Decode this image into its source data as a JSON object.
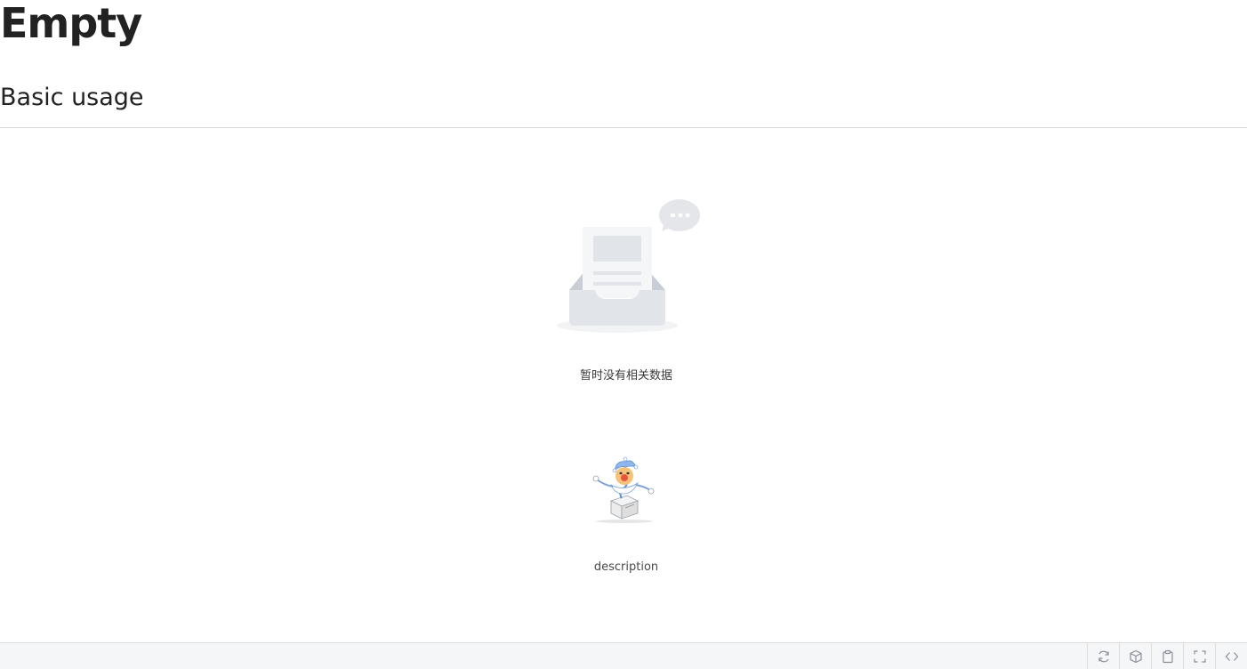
{
  "page": {
    "title": "Empty",
    "section_title": "Basic usage"
  },
  "empty_default": {
    "description": "暂时没有相关数据",
    "image": "empty-inbox-illustration"
  },
  "empty_custom": {
    "description": "description",
    "image": "jester-in-box-illustration"
  },
  "toolbar": {
    "buttons": [
      {
        "icon": "refresh-icon"
      },
      {
        "icon": "cube-icon"
      },
      {
        "icon": "clipboard-icon"
      },
      {
        "icon": "fullscreen-icon"
      },
      {
        "icon": "code-icon"
      }
    ]
  }
}
